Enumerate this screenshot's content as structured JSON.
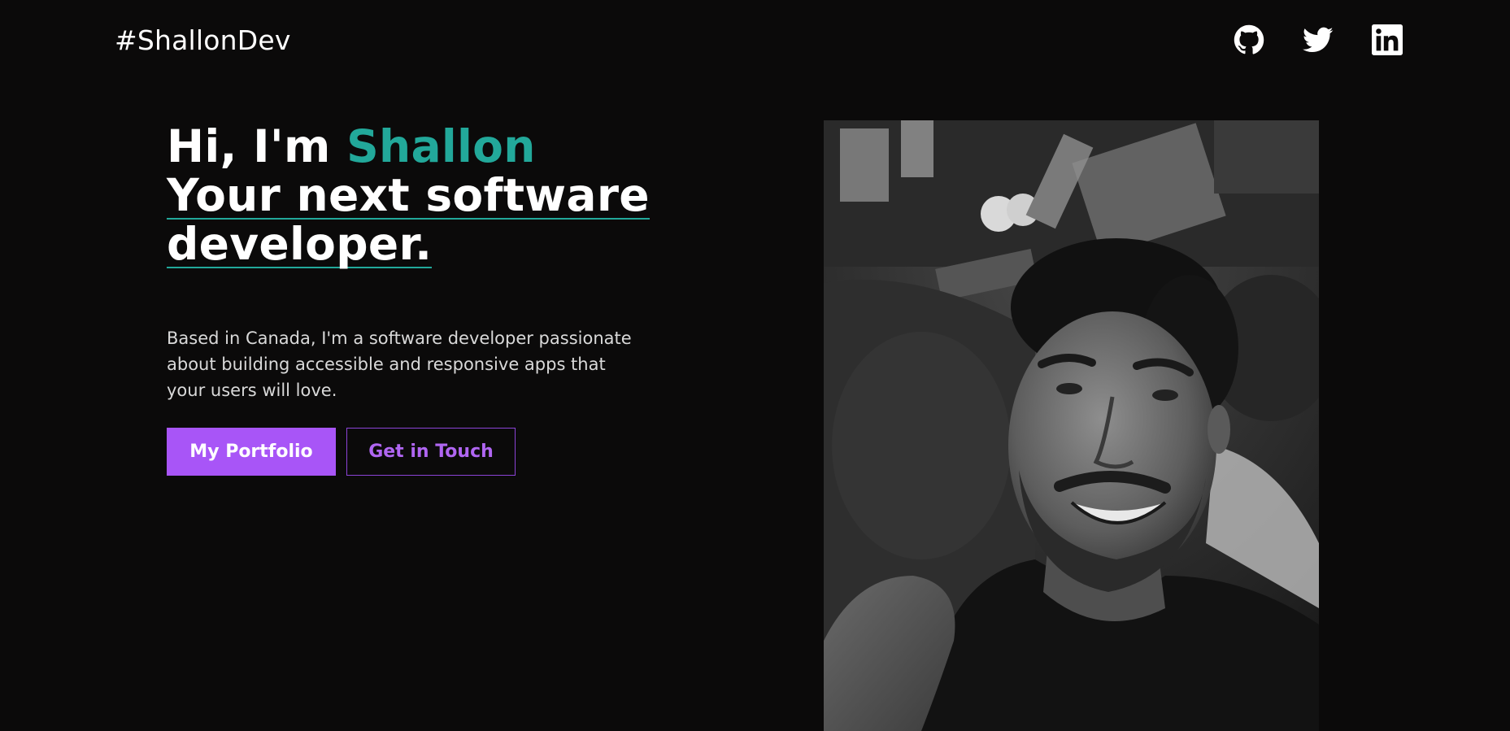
{
  "header": {
    "brand": "#ShallonDev",
    "social": [
      {
        "icon": "github-icon"
      },
      {
        "icon": "twitter-icon"
      },
      {
        "icon": "linkedin-icon"
      }
    ]
  },
  "hero": {
    "greeting_prefix": "Hi, I'm ",
    "name": "Shallon",
    "tagline_line1": "Your next software",
    "tagline_line2": "developer.",
    "intro": "Based in Canada, I'm a software developer passionate about building accessible and responsive apps that your users will love.",
    "primary_button": "My Portfolio",
    "secondary_button": "Get in Touch"
  },
  "colors": {
    "background": "#0b0a0a",
    "accent": "#22a89a",
    "primary": "#a855f7"
  }
}
